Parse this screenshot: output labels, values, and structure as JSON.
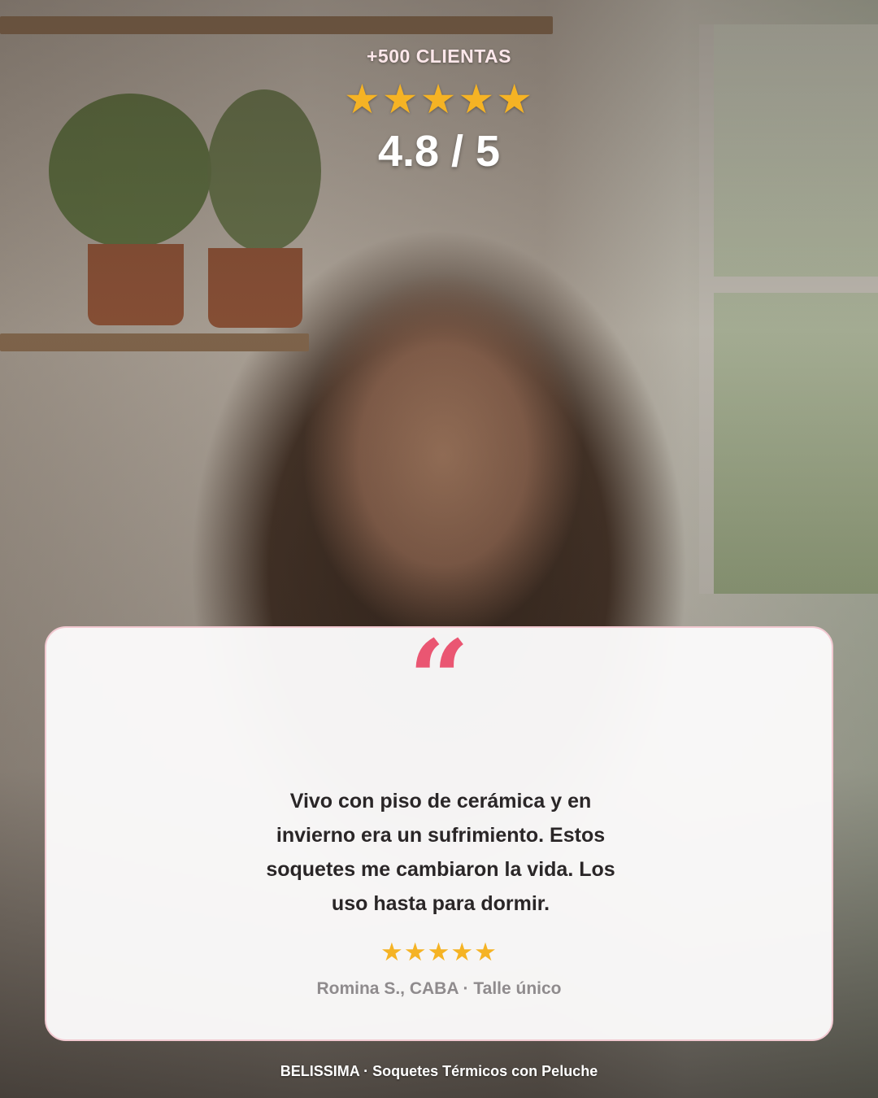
{
  "header": {
    "eyebrow": "+500 CLIENTAS",
    "stars": "★★★★★",
    "score": "4.8 / 5"
  },
  "rating": {
    "value": 4.8,
    "max": 5
  },
  "testimonial": {
    "quote_glyph": "“",
    "text": "Vivo con piso de cerámica y en invierno era un sufrimiento. Estos soquetes me cambiaron la vida. Los uso hasta para dormir.",
    "stars": "★★★★★",
    "author": "Romina S., CABA · Talle único"
  },
  "footer": {
    "brand_line": "BELISSIMA · Soquetes Térmicos con Peluche"
  },
  "colors": {
    "accent_pink": "#ea5672",
    "star_gold": "#f5b324",
    "card_bg": "#fbfafa",
    "card_border": "#f2c9d1"
  }
}
